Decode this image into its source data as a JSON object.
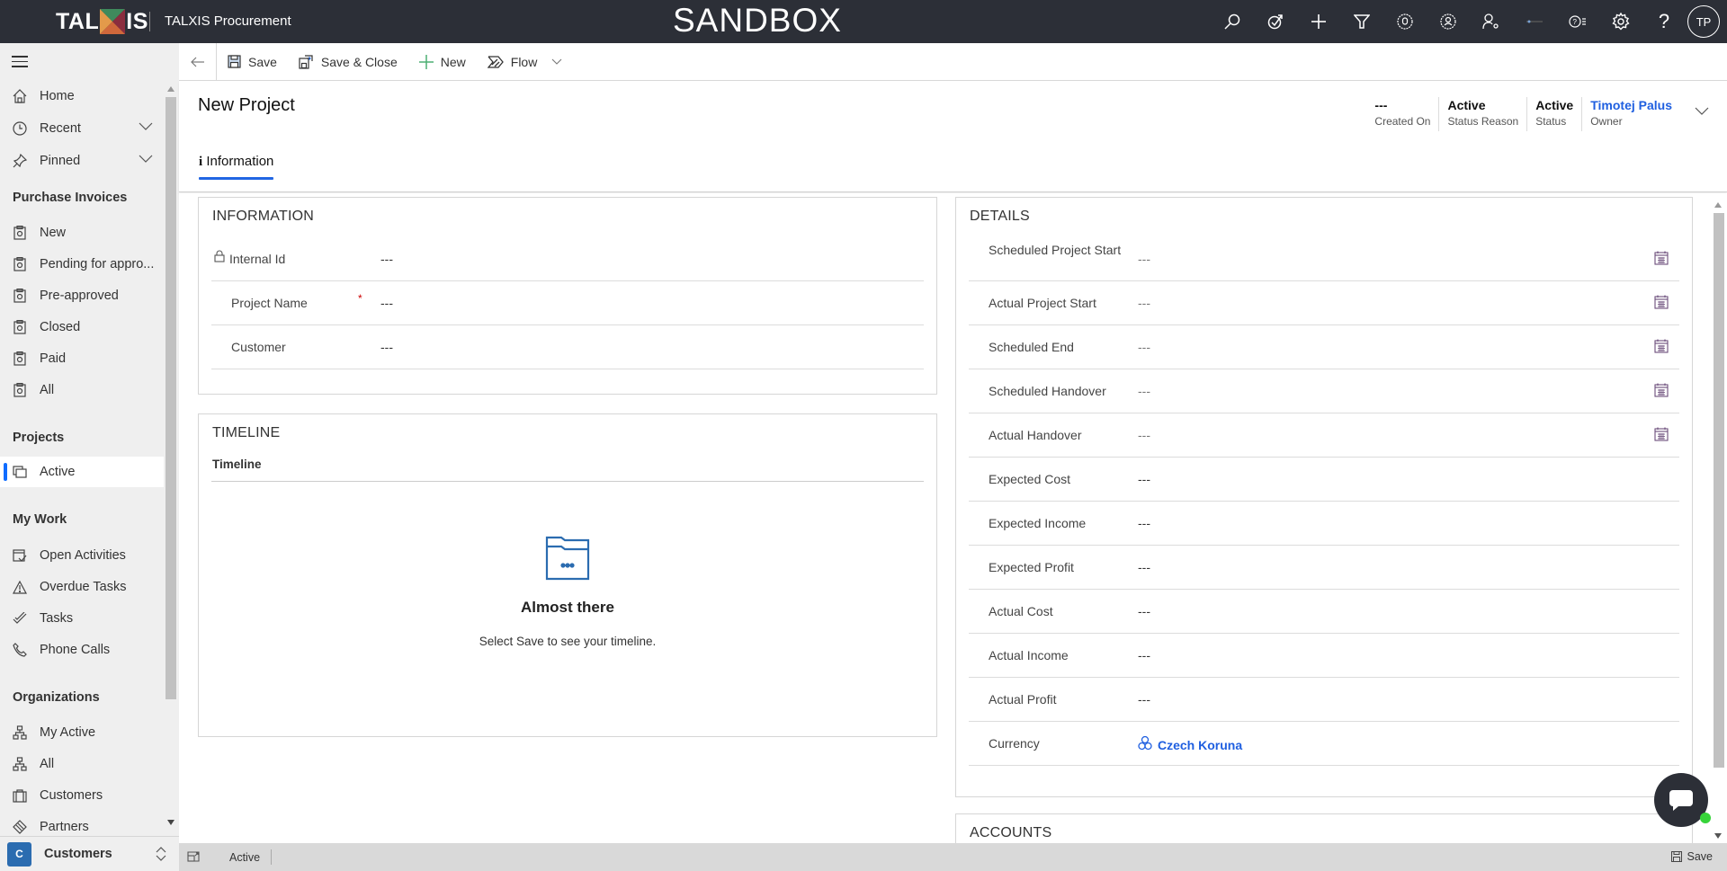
{
  "topbar": {
    "logo": "TALXIS",
    "app_name": "TALXIS Procurement",
    "environment_banner": "SANDBOX",
    "icons": [
      "search-icon",
      "assistant-icon",
      "new-icon",
      "filter-icon",
      "notification-icon",
      "persona-icon",
      "user-settings-icon",
      "loading-icon",
      "help-list-icon",
      "settings-icon",
      "help-icon"
    ],
    "avatar_initials": "TP"
  },
  "sidebar": {
    "top_items": [
      {
        "label": "Home",
        "icon": "home-icon"
      },
      {
        "label": "Recent",
        "icon": "clock-icon",
        "expandable": true
      },
      {
        "label": "Pinned",
        "icon": "pin-icon",
        "expandable": true
      }
    ],
    "groups": [
      {
        "title": "Purchase Invoices",
        "items": [
          {
            "label": "New",
            "icon": "invoice-icon"
          },
          {
            "label": "Pending for appro...",
            "icon": "invoice-icon"
          },
          {
            "label": "Pre-approved",
            "icon": "invoice-icon"
          },
          {
            "label": "Closed",
            "icon": "invoice-icon"
          },
          {
            "label": "Paid",
            "icon": "invoice-icon"
          },
          {
            "label": "All",
            "icon": "invoice-icon"
          }
        ]
      },
      {
        "title": "Projects",
        "items": [
          {
            "label": "Active",
            "icon": "project-icon",
            "selected": true
          }
        ]
      },
      {
        "title": "My Work",
        "items": [
          {
            "label": "Open Activities",
            "icon": "calendar-check-icon"
          },
          {
            "label": "Overdue Tasks",
            "icon": "warning-icon"
          },
          {
            "label": "Tasks",
            "icon": "task-icon"
          },
          {
            "label": "Phone Calls",
            "icon": "phone-icon"
          }
        ]
      },
      {
        "title": "Organizations",
        "items": [
          {
            "label": "My Active",
            "icon": "org-chart-icon"
          },
          {
            "label": "All",
            "icon": "org-chart-icon"
          },
          {
            "label": "Customers",
            "icon": "briefcase-icon"
          },
          {
            "label": "Partners",
            "icon": "handshake-icon"
          }
        ]
      }
    ],
    "area_switcher": {
      "badge": "C",
      "label": "Customers"
    }
  },
  "commandbar": {
    "save": "Save",
    "save_close": "Save & Close",
    "new": "New",
    "flow": "Flow"
  },
  "header": {
    "title": "New Project",
    "fields": [
      {
        "value": "---",
        "label": "Created On"
      },
      {
        "value": "Active",
        "label": "Status Reason"
      },
      {
        "value": "Active",
        "label": "Status"
      },
      {
        "value": "Timotej Palus",
        "label": "Owner",
        "link": true
      }
    ],
    "tabs": [
      {
        "label": "Information",
        "icon": "info-icon",
        "selected": true
      }
    ]
  },
  "information": {
    "title": "INFORMATION",
    "fields": [
      {
        "label": "Internal Id",
        "value": "---",
        "locked": true
      },
      {
        "label": "Project Name",
        "value": "---",
        "required": true
      },
      {
        "label": "Customer",
        "value": "---"
      }
    ]
  },
  "timeline": {
    "title": "TIMELINE",
    "subtitle": "Timeline",
    "empty_title": "Almost there",
    "empty_message": "Select Save to see your timeline."
  },
  "details": {
    "title": "DETAILS",
    "fields": [
      {
        "label": "Scheduled Project Start",
        "value": "---",
        "date": true
      },
      {
        "label": "Actual Project Start",
        "value": "---",
        "date": true
      },
      {
        "label": "Scheduled End",
        "value": "---",
        "date": true
      },
      {
        "label": "Scheduled Handover",
        "value": "---",
        "date": true
      },
      {
        "label": "Actual Handover",
        "value": "---",
        "date": true
      },
      {
        "label": "Expected Cost",
        "value": "---"
      },
      {
        "label": "Expected Income",
        "value": "---"
      },
      {
        "label": "Expected Profit",
        "value": "---"
      },
      {
        "label": "Actual Cost",
        "value": "---"
      },
      {
        "label": "Actual Income",
        "value": "---"
      },
      {
        "label": "Actual Profit",
        "value": "---"
      },
      {
        "label": "Currency",
        "value": "Czech Koruna",
        "lookup": true
      }
    ]
  },
  "accounts": {
    "title": "ACCOUNTS"
  },
  "statusbar": {
    "status": "Active",
    "save": "Save"
  },
  "colors": {
    "topbar": "#2c2f37",
    "accent": "#2266e3",
    "link": "#1f5fe0",
    "required": "#cc0000",
    "chat_online": "#37d43a"
  }
}
